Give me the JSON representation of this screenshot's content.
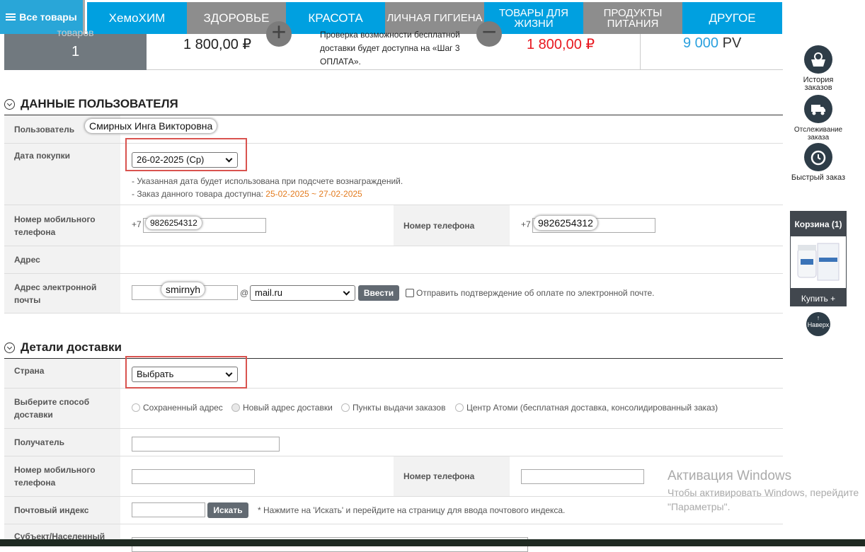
{
  "nav": {
    "all_label": "Все товары",
    "items": [
      "ХемоХИМ",
      "ЗДОРОВЬЕ",
      "КРАСОТА",
      "ЛИЧНАЯ ГИГИЕНА",
      "ТОВАРЫ ДЛЯ ЖИЗНИ",
      "ПРОДУКТЫ ПИТАНИЯ",
      "ДРУГОЕ"
    ]
  },
  "summary": {
    "goods_label": "товаров",
    "goods_count": "1",
    "price": "1 800,00 ₽",
    "plus": "+",
    "delivery_note": "Проверка возможности бесплатной доставки будет доступна на «Шаг 3 ОПЛАТА».",
    "minus": "−",
    "total": "1 800,00 ₽",
    "pv_value": "9 000",
    "pv_unit": "PV"
  },
  "user_section": {
    "title": "ДАННЫЕ ПОЛЬЗОВАТЕЛЯ",
    "user_label": "Пользователь",
    "user_name": "Смирных Инга Викторовна",
    "purchase_date_label": "Дата покупки",
    "purchase_date_value": "26-02-2025 (Ср)",
    "date_note_1": "- Указанная дата будет использована при подсчете вознаграждений.",
    "date_note_2_prefix": "- Заказ данного товара доступна:",
    "date_note_2_range": "25-02-2025 ~ 27-02-2025",
    "mobile_label": "Номер мобильного телефона",
    "mobile_prefix": "+7",
    "mobile_value": "9826254312",
    "phone_label": "Номер телефона",
    "phone_prefix": "+7",
    "phone_value": "9826254312",
    "address_label": "Адрес",
    "email_label": "Адрес электронной почты",
    "email_user": "smirnyh",
    "email_at": "@",
    "email_domain": "mail.ru",
    "enter_button": "Ввести",
    "email_confirm_label": "Отправить подтверждение об оплате по электронной почте."
  },
  "delivery_section": {
    "title": "Детали доставки",
    "country_label": "Страна",
    "country_value": "Выбрать",
    "method_label": "Выберите способ доставки",
    "methods": [
      "Сохраненный адрес",
      "Новый адрес доставки",
      "Пункты выдачи заказов",
      "Центр Атоми (бесплатная доставка, консолидированный заказ)"
    ],
    "selected_method": "Новый адрес доставки",
    "recipient_label": "Получатель",
    "mobile_label": "Номер мобильного телефона",
    "phone_label": "Номер телефона",
    "postal_label": "Почтовый индекс",
    "search_button": "Искать",
    "postal_note": "* Нажмите на 'Искать' и перейдите на страницу для ввода почтового индекса.",
    "subject_label": "Субъект/Населенный"
  },
  "sidebar": {
    "history": "История заказов",
    "tracking": "Отслеживание заказа",
    "quick": "Быстрый заказ",
    "cart_title": "Корзина (1)",
    "buy": "Купить +",
    "top_arrow": "↑",
    "top": "Наверх"
  },
  "watermark": {
    "line1": "Активация Windows",
    "line2": "Чтобы активировать Windows, перейдите",
    "line3": "\"Параметры\"."
  }
}
